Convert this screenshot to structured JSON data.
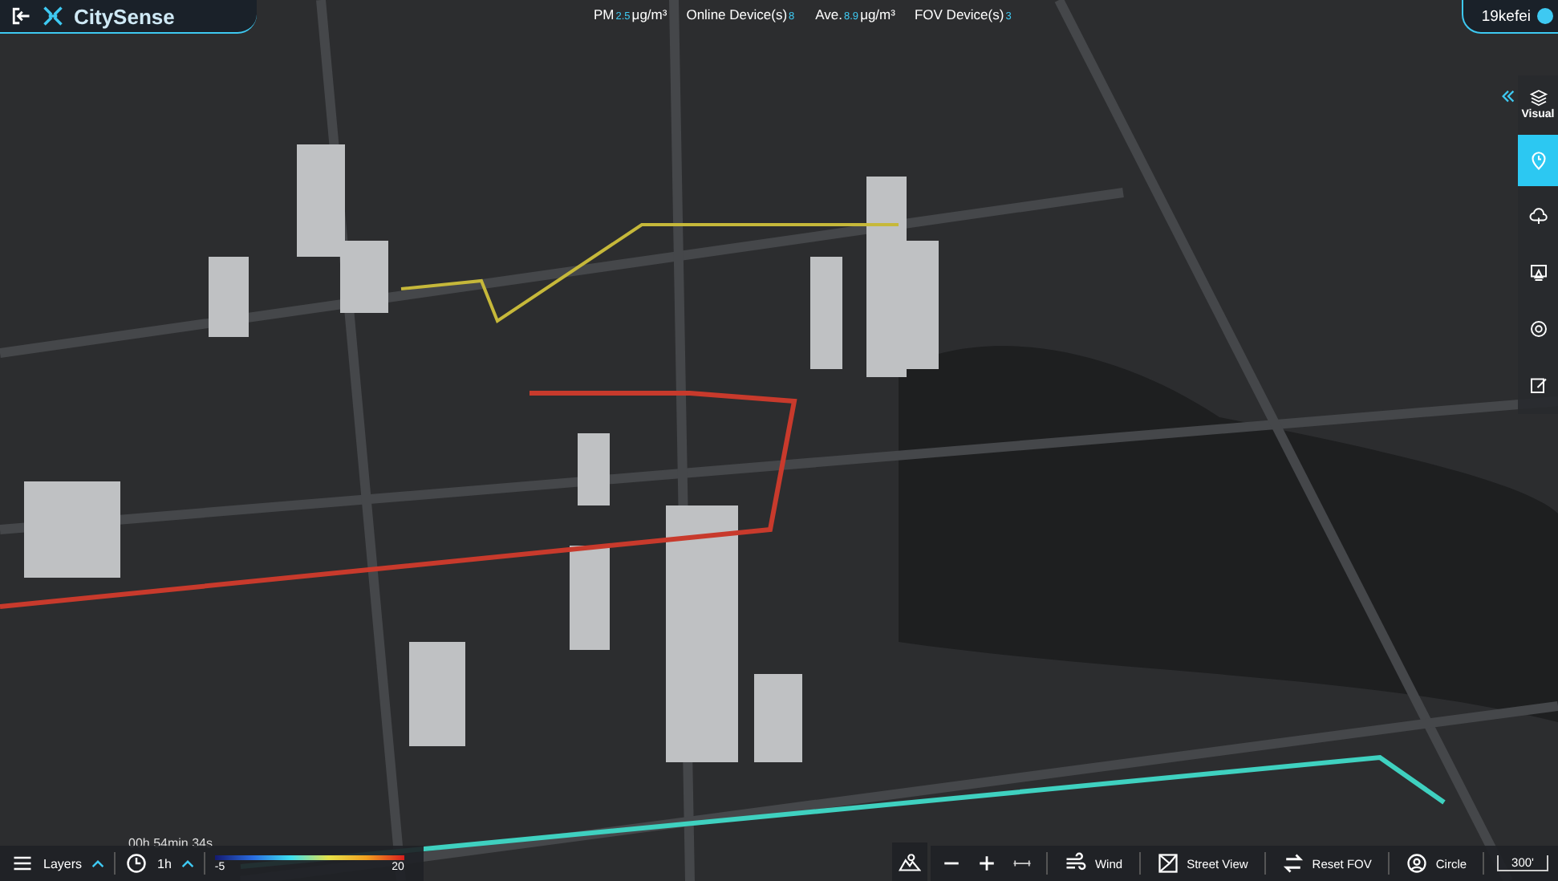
{
  "header": {
    "app_name": "CitySense",
    "stats": [
      {
        "label": "PM",
        "value": "2.5",
        "unit": "μg/m³"
      },
      {
        "label": "Online Device(s)",
        "value": "8"
      },
      {
        "label": "Ave.",
        "value": "8.9",
        "unit": "μg/m³"
      },
      {
        "label": "FOV Device(s)",
        "value": "3"
      }
    ],
    "user": "19kefei"
  },
  "map": {
    "timer": "00h 54min 34s"
  },
  "right_toolbar": {
    "items": [
      {
        "label": "Visual",
        "selected": false
      },
      {
        "selected": true
      },
      {
        "selected": false
      },
      {
        "selected": false
      },
      {
        "selected": false
      },
      {
        "selected": false
      }
    ]
  },
  "bottom_left": {
    "layers_label": "Layers",
    "time_value": "1h",
    "legend": {
      "min": "-5",
      "max": "20"
    }
  },
  "bottom_right": {
    "tools": [
      "Wind",
      "Street View",
      "Reset FOV",
      "Circle"
    ],
    "scale": "300'"
  }
}
